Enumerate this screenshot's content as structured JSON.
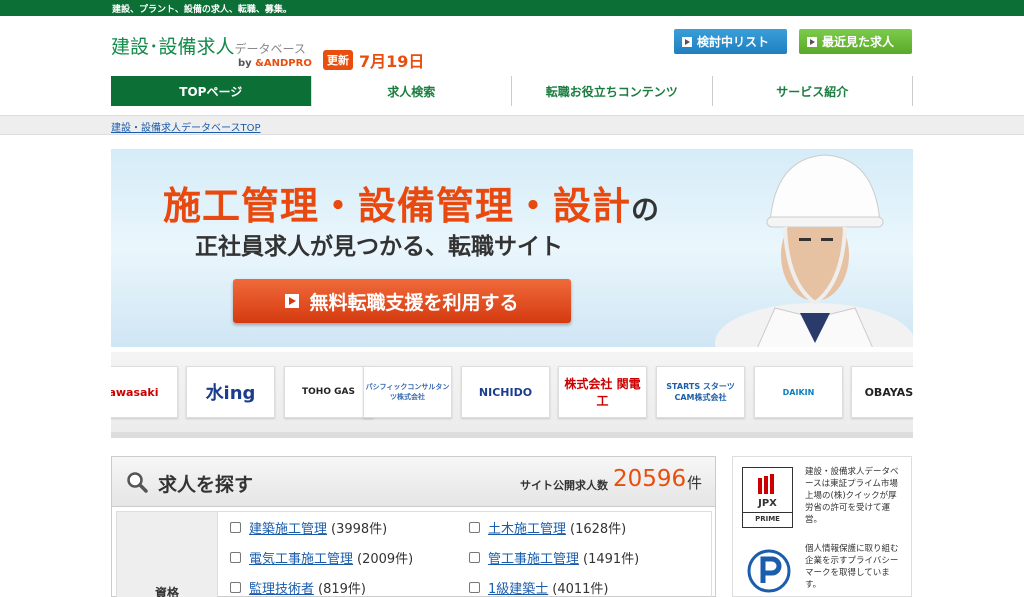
{
  "topbar": {
    "tagline": "建設、プラント、設備の求人、転職、募集。"
  },
  "logo": {
    "main": "建設･設備求人",
    "sub": "データベース",
    "by": "by",
    "brand": "&ANDPRO"
  },
  "update": {
    "badge": "更新",
    "date": "7月19日"
  },
  "header_buttons": {
    "consider_list": "検討中リスト",
    "recently_viewed": "最近見た求人"
  },
  "gnav": [
    {
      "label": "TOPページ"
    },
    {
      "label": "求人検索"
    },
    {
      "label": "転職お役立ちコンテンツ"
    },
    {
      "label": "サービス紹介"
    }
  ],
  "breadcrumb": {
    "home": "建設・設備求人データベースTOP"
  },
  "hero": {
    "headline": "施工管理・設備管理・設計",
    "headline_particle": "の",
    "subheadline": "正社員求人が見つかる、転職サイト",
    "cta": "無料転職支援を利用する"
  },
  "company_logos": [
    {
      "text": "awasaki"
    },
    {
      "text": "水ing"
    },
    {
      "text": "TOHO GAS"
    },
    {
      "text": "パシフィックコンサルタンツ株式会社"
    },
    {
      "text": "NICHIDO"
    },
    {
      "text": "株式会社 関電工"
    },
    {
      "text": "STARTS スターツCAM株式会社"
    },
    {
      "text": "DAIKIN"
    },
    {
      "text": "OBAYASHI"
    }
  ],
  "search": {
    "title": "求人を探す",
    "count_label": "サイト公開求人数",
    "count": "20596",
    "count_unit": "件",
    "row_header": "資格",
    "options": [
      {
        "label": "建築施工管理",
        "count": "(3998件)"
      },
      {
        "label": "土木施工管理",
        "count": "(1628件)"
      },
      {
        "label": "電気工事施工管理",
        "count": "(2009件)"
      },
      {
        "label": "管工事施工管理",
        "count": "(1491件)"
      },
      {
        "label": "監理技術者",
        "count": "(819件)"
      },
      {
        "label": "1級建築士",
        "count": "(4011件)"
      }
    ]
  },
  "sidebar": {
    "jpx_top": "JPX",
    "jpx_bottom": "PRIME",
    "jpx_text": "建設・設備求人データベースは東証プライム市場上場の(株)クイックが厚労省の許可を受けて運営。",
    "privacy_text": "個人情報保護に取り組む企業を示すプライバシーマークを取得しています。"
  },
  "colors": {
    "brand_green": "#0b6f36",
    "accent_orange": "#e84e0e",
    "link_blue": "#1a5dad"
  }
}
